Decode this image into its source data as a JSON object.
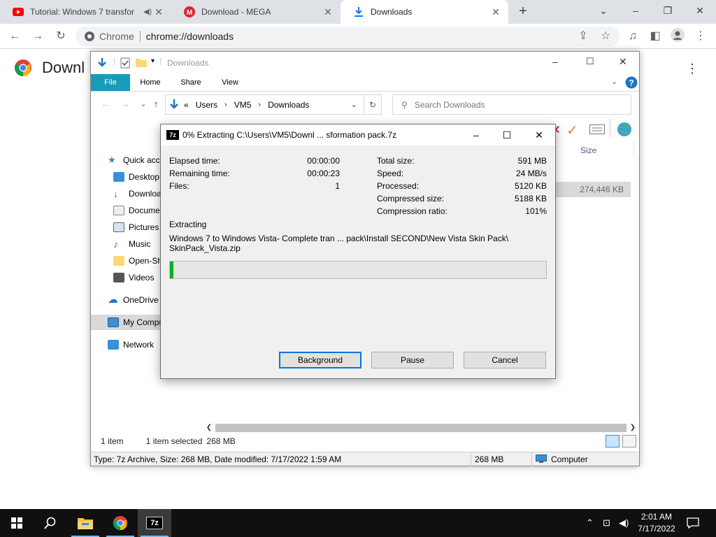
{
  "browser": {
    "tabs": [
      {
        "label": "Tutorial: Windows 7 transfor",
        "favicon": "youtube-icon",
        "audio": true
      },
      {
        "label": "Download - MEGA",
        "favicon": "mega-icon"
      },
      {
        "label": "Downloads",
        "favicon": "download-icon",
        "active": true
      }
    ],
    "site_label": "Chrome",
    "url": "chrome://downloads",
    "page_title": "Downl"
  },
  "explorer": {
    "title": "Downloads",
    "ribbon_tabs": [
      "File",
      "Home",
      "Share",
      "View"
    ],
    "address": {
      "prefix": "«",
      "crumbs": [
        "Users",
        "VM5",
        "Downloads"
      ]
    },
    "search_placeholder": "Search Downloads",
    "nav_items": [
      {
        "label": "Quick access"
      },
      {
        "label": "Desktop"
      },
      {
        "label": "Downloads"
      },
      {
        "label": "Documents"
      },
      {
        "label": "Pictures"
      },
      {
        "label": "Music"
      },
      {
        "label": "Open-Shell"
      },
      {
        "label": "Videos"
      },
      {
        "label": "OneDrive"
      },
      {
        "label": "My Computer"
      },
      {
        "label": "Network"
      }
    ],
    "column_size": "Size",
    "file_size": "274,446 KB",
    "status": {
      "items": "1 item",
      "selected": "1 item selected",
      "selected_size": "268 MB"
    },
    "details": {
      "text": "Type: 7z Archive, Size: 268 MB, Date modified: 7/17/2022 1:59 AM",
      "size": "268 MB",
      "location": "Computer"
    }
  },
  "dialog": {
    "title": "0% Extracting C:\\Users\\VM5\\Downl ... sformation pack.7z",
    "left_stats": [
      {
        "label": "Elapsed time:",
        "value": "00:00:00"
      },
      {
        "label": "Remaining time:",
        "value": "00:00:23"
      },
      {
        "label": "Files:",
        "value": "1"
      }
    ],
    "right_stats": [
      {
        "label": "Total size:",
        "value": "591 MB"
      },
      {
        "label": "Speed:",
        "value": "24 MB/s"
      },
      {
        "label": "Processed:",
        "value": "5120 KB"
      },
      {
        "label": "Compressed size:",
        "value": "5188 KB"
      },
      {
        "label": "Compression ratio:",
        "value": "101%"
      }
    ],
    "operation": "Extracting",
    "path_line1": "Windows 7 to Windows Vista- Complete tran ...  pack\\Install SECOND\\New Vista Skin Pack\\",
    "path_line2": "SkinPack_Vista.zip",
    "progress_fraction": 0.01,
    "buttons": {
      "background": "Background",
      "pause": "Pause",
      "cancel": "Cancel"
    }
  },
  "taskbar": {
    "time": "2:01 AM",
    "date": "7/17/2022",
    "apps": [
      "start-icon",
      "search-icon",
      "file-explorer-icon",
      "chrome-icon",
      "7zip-icon"
    ]
  },
  "colors": {
    "ribbon_file": "#189bb8",
    "progress_green": "#06b025",
    "accent": "#0078d7"
  }
}
